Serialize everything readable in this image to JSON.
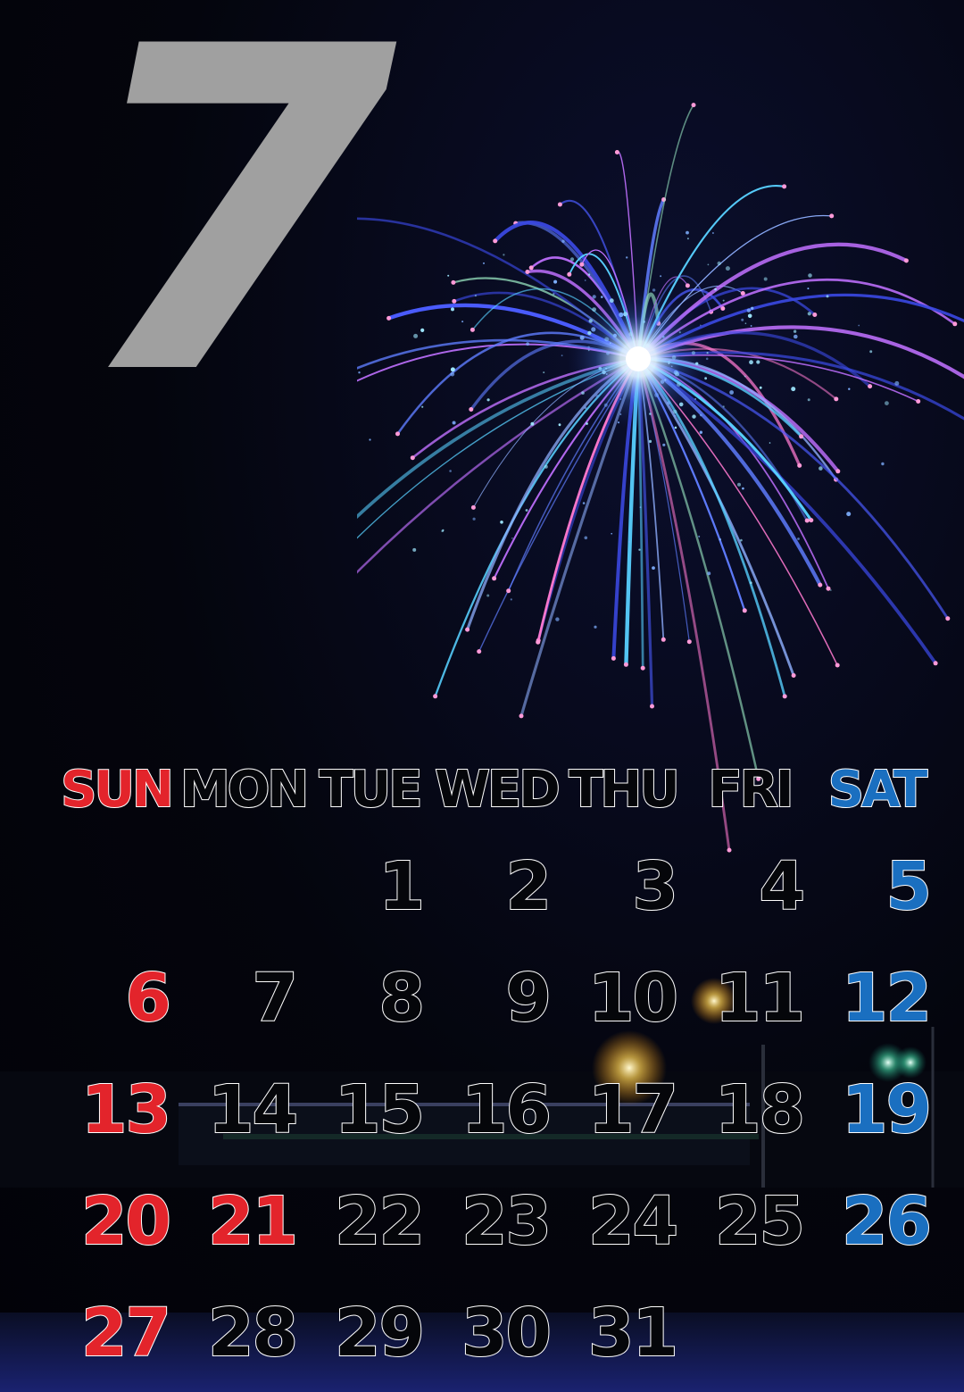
{
  "month": "7",
  "weekdays": [
    "SUN",
    "MON",
    "TUE",
    "WED",
    "THU",
    "FRI",
    "SAT"
  ],
  "weeks": [
    [
      "",
      "",
      "1",
      "2",
      "3",
      "4",
      "5"
    ],
    [
      "6",
      "7",
      "8",
      "9",
      "10",
      "11",
      "12"
    ],
    [
      "13",
      "14",
      "15",
      "16",
      "17",
      "18",
      "19"
    ],
    [
      "20",
      "21",
      "22",
      "23",
      "24",
      "25",
      "26"
    ],
    [
      "27",
      "28",
      "29",
      "30",
      "31",
      "",
      ""
    ]
  ],
  "holidays": [
    "21"
  ],
  "colors": {
    "sunday": "#e3242b",
    "saturday": "#1a6fc0",
    "weekday_fill": "#05060a",
    "outline": "#ffffff",
    "month_numeral": "#a0a0a0",
    "background": "#04050d"
  }
}
